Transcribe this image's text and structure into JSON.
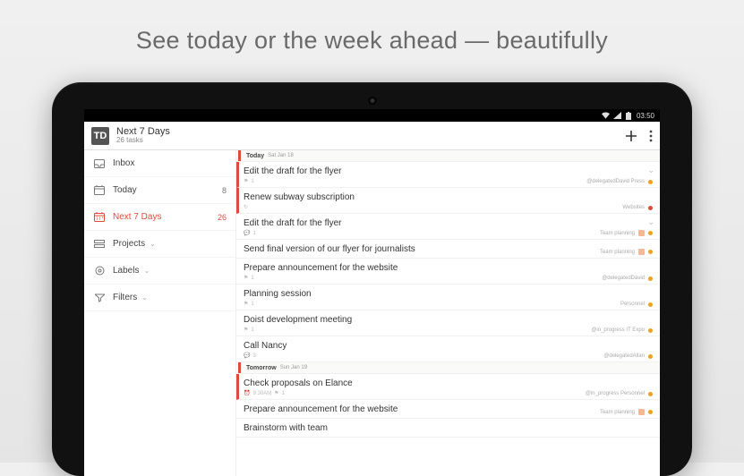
{
  "headline": "See today or the week ahead — beautifully",
  "statusbar": {
    "time": "03:50"
  },
  "app": {
    "title": "Next 7 Days",
    "subtitle": "26 tasks"
  },
  "sidebar": {
    "items": [
      {
        "label": "Inbox",
        "badge": "",
        "icon": "inbox"
      },
      {
        "label": "Today",
        "badge": "8",
        "icon": "today"
      },
      {
        "label": "Next 7 Days",
        "badge": "26",
        "icon": "week",
        "active": true
      },
      {
        "label": "Projects",
        "badge": "",
        "icon": "projects",
        "expandable": true
      },
      {
        "label": "Labels",
        "badge": "",
        "icon": "labels",
        "expandable": true
      },
      {
        "label": "Filters",
        "badge": "",
        "icon": "filters",
        "expandable": true
      }
    ]
  },
  "days": [
    {
      "name": "Today",
      "date": "Sat Jan 18"
    },
    {
      "name": "Tomorrow",
      "date": "Sun Jan 19"
    }
  ],
  "tasks_today": [
    {
      "title": "Edit the draft for the flyer",
      "pri": true,
      "meta_icon": "flag",
      "meta_text": "1",
      "right": "@delegatedDavid  Press",
      "dot": "orange",
      "chev": true
    },
    {
      "title": "Renew subway subscription",
      "pri": true,
      "meta_icon": "repeat",
      "meta_text": "",
      "right": "Websites",
      "dot": "red",
      "chev": false
    },
    {
      "title": "Edit the draft for the flyer",
      "pri": false,
      "meta_icon": "comment",
      "meta_text": "1",
      "right": "Team planning",
      "dot": "orange",
      "chev": true,
      "avatar": true
    },
    {
      "title": "Send final version of our flyer for journalists",
      "pri": false,
      "meta_icon": "",
      "meta_text": "",
      "right": "Team planning",
      "dot": "orange",
      "chev": false,
      "avatar": true
    },
    {
      "title": "Prepare announcement for the website",
      "pri": false,
      "meta_icon": "flag",
      "meta_text": "1",
      "right": "@delegatedDavid",
      "dot": "orange",
      "chev": false
    },
    {
      "title": "Planning session",
      "pri": false,
      "meta_icon": "flag",
      "meta_text": "1",
      "right": "Personnel",
      "dot": "orange",
      "chev": false
    },
    {
      "title": "Doist development meeting",
      "pri": false,
      "meta_icon": "flag",
      "meta_text": "1",
      "right": "@in_progress  IT Expo",
      "dot": "orange",
      "chev": false
    },
    {
      "title": "Call Nancy",
      "pri": false,
      "meta_icon": "comment",
      "meta_text": "3",
      "right": "@delegatedAllan",
      "dot": "orange",
      "chev": false
    }
  ],
  "tasks_tomorrow": [
    {
      "title": "Check proposals on Elance",
      "pri": true,
      "meta_icon": "clock",
      "meta_text": "9:30AM",
      "extra": "1",
      "right": "@in_progress  Personnel",
      "dot": "orange",
      "chev": false
    },
    {
      "title": "Prepare announcement for the website",
      "pri": false,
      "meta_icon": "",
      "meta_text": "",
      "right": "Team planning",
      "dot": "orange",
      "chev": false,
      "avatar": true
    },
    {
      "title": "Brainstorm with team",
      "pri": false,
      "meta_icon": "",
      "meta_text": "",
      "right": "",
      "dot": "",
      "chev": false
    }
  ]
}
